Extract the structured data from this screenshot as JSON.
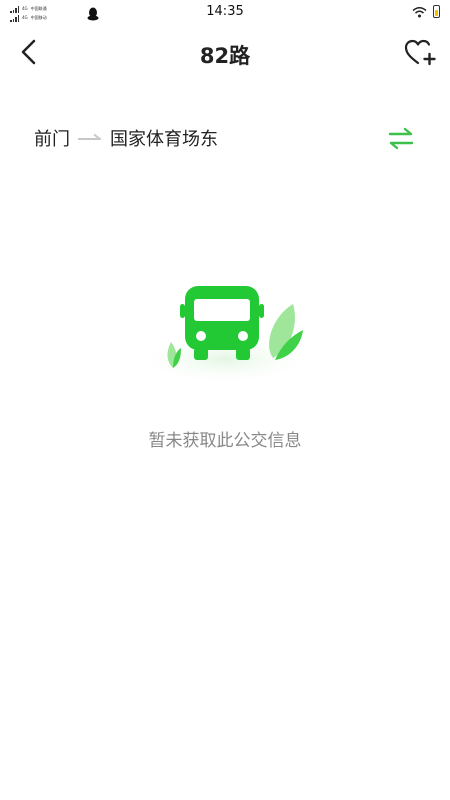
{
  "status_bar": {
    "time": "14:35",
    "signal": [
      {
        "label": "4G",
        "carrier": "中国联通"
      },
      {
        "label": "4G",
        "carrier": "中国移动"
      }
    ],
    "icons": [
      "qq-icon",
      "wifi-icon",
      "battery-icon"
    ]
  },
  "header": {
    "title": "82路",
    "back_icon": "chevron-left-icon",
    "favorite_icon": "heart-plus-icon"
  },
  "route": {
    "from": "前门",
    "to": "国家体育场东",
    "swap_icon": "swap-arrows-icon"
  },
  "empty_state": {
    "illustration": "bus-icon",
    "message": "暂未获取此公交信息"
  },
  "colors": {
    "accent_green": "#22c934",
    "swap_green": "#3ec14a",
    "text_dark": "#222222",
    "text_muted": "#888888"
  }
}
